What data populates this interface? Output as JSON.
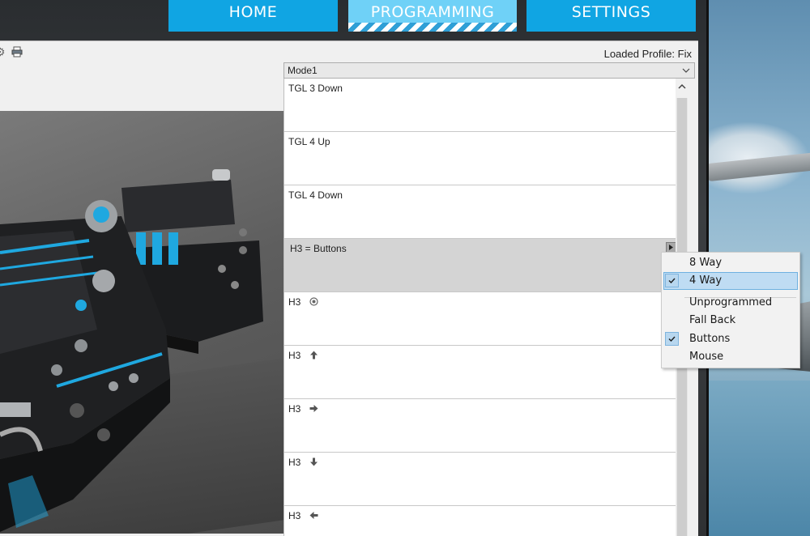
{
  "nav": {
    "tabs": [
      {
        "label": "HOME"
      },
      {
        "label": "PROGRAMMING"
      },
      {
        "label": "SETTINGS"
      }
    ],
    "active": "PROGRAMMING"
  },
  "toolbar": {
    "loaded_profile": "Loaded Profile: Fix",
    "icons": [
      "gear-icon",
      "printer-icon"
    ]
  },
  "mode": {
    "selected": "Mode1"
  },
  "rows": [
    {
      "label": "TGL 3 Down"
    },
    {
      "label": "TGL 4 Up"
    },
    {
      "label": "TGL 4 Down"
    },
    {
      "label": "H3 = Buttons"
    },
    {
      "label": "H3",
      "icon": "center-press-icon"
    },
    {
      "label": "H3",
      "icon": "arrow-up-icon"
    },
    {
      "label": "H3",
      "icon": "arrow-right-icon"
    },
    {
      "label": "H3",
      "icon": "arrow-down-icon"
    },
    {
      "label": "H3",
      "icon": "arrow-left-icon"
    }
  ],
  "context_menu": {
    "items": [
      {
        "label": "8 Way",
        "checked": false
      },
      {
        "label": "4 Way",
        "checked": true,
        "highlighted": true
      },
      {
        "label": "Unprogrammed",
        "checked": false
      },
      {
        "label": "Fall Back",
        "checked": false
      },
      {
        "label": "Buttons",
        "checked": true
      },
      {
        "label": "Mouse",
        "checked": false
      }
    ]
  },
  "colors": {
    "nav_blue": "#10a5e3",
    "nav_active": "#6fd1f7",
    "accent_device": "#1fa8e0",
    "menu_highlight": "#bfdcf3"
  }
}
